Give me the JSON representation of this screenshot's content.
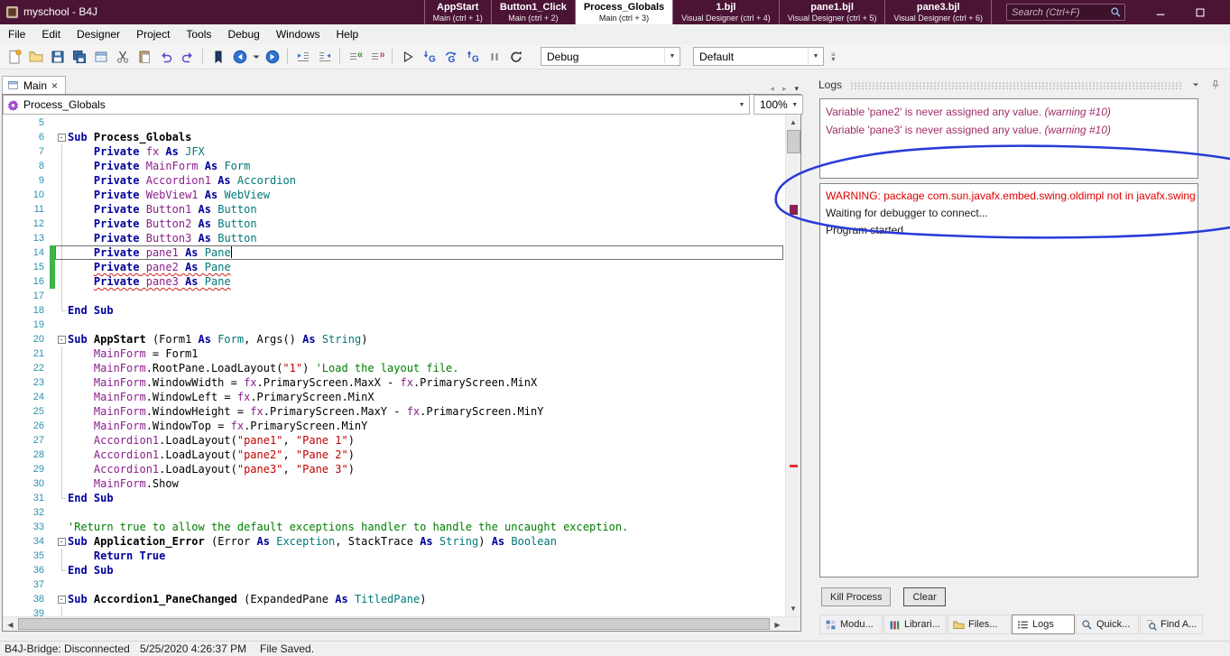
{
  "colors": {
    "titlebar_bg": "#4b1434",
    "annotation_blue": "#2a3bd8",
    "keyword": "#00009b",
    "variable": "#8b1f8b",
    "type": "#007878",
    "string": "#c00000",
    "comment": "#007f00",
    "linenum": "#2b91af",
    "edit_marker_green": "#3cb44a",
    "warn_text": "#a12d66",
    "error_red": "#e00000"
  },
  "titlebar": {
    "app_title": "myschool - B4J",
    "tabs": [
      {
        "title": "AppStart",
        "subtitle": "Main  (ctrl + 1)",
        "active": false
      },
      {
        "title": "Button1_Click",
        "subtitle": "Main  (ctrl + 2)",
        "active": false
      },
      {
        "title": "Process_Globals",
        "subtitle": "Main  (ctrl + 3)",
        "active": true
      },
      {
        "title": "1.bjl",
        "subtitle": "Visual Designer  (ctrl + 4)",
        "active": false
      },
      {
        "title": "pane1.bjl",
        "subtitle": "Visual Designer  (ctrl + 5)",
        "active": false
      },
      {
        "title": "pane3.bjl",
        "subtitle": "Visual Designer  (ctrl + 6)",
        "active": false
      }
    ],
    "search_placeholder": "Search (Ctrl+F)"
  },
  "menubar": {
    "items": [
      "File",
      "Edit",
      "Designer",
      "Project",
      "Tools",
      "Debug",
      "Windows",
      "Help"
    ]
  },
  "toolbar": {
    "icons": [
      "new-file-icon",
      "open-project-icon",
      "save-icon",
      "save-all-icon",
      "designer-icon",
      "cut-icon",
      "paste-icon",
      "undo-icon",
      "redo-icon",
      "sep",
      "bookmark-icon",
      "nav-back-icon",
      "dropdown-arrow-icon",
      "nav-forward-icon",
      "sep",
      "indent-icon",
      "outdent-icon",
      "sep",
      "comment-icon",
      "uncomment-icon",
      "sep",
      "run-icon",
      "step-into-icon",
      "step-over-icon",
      "step-out-icon",
      "pause-icon",
      "restart-icon"
    ],
    "debug_mode": "Debug",
    "build_config": "Default"
  },
  "editor_tab": {
    "label": "Main",
    "close": "×"
  },
  "code_header": {
    "module": "Process_Globals",
    "zoom": "100%"
  },
  "code": {
    "lines": [
      {
        "n": 5,
        "t": []
      },
      {
        "n": 6,
        "fold": true,
        "t": [
          [
            "kw",
            "Sub"
          ],
          [
            "pl",
            " "
          ],
          [
            "nm",
            "Process_Globals"
          ]
        ]
      },
      {
        "n": 7,
        "guide": true,
        "t": [
          [
            "pl",
            "    "
          ],
          [
            "kw",
            "Private"
          ],
          [
            "pl",
            " "
          ],
          [
            "vr",
            "fx"
          ],
          [
            "pl",
            " "
          ],
          [
            "kw",
            "As"
          ],
          [
            "pl",
            " "
          ],
          [
            "ty",
            "JFX"
          ]
        ]
      },
      {
        "n": 8,
        "guide": true,
        "t": [
          [
            "pl",
            "    "
          ],
          [
            "kw",
            "Private"
          ],
          [
            "pl",
            " "
          ],
          [
            "vr",
            "MainForm"
          ],
          [
            "pl",
            " "
          ],
          [
            "kw",
            "As"
          ],
          [
            "pl",
            " "
          ],
          [
            "ty",
            "Form"
          ]
        ]
      },
      {
        "n": 9,
        "guide": true,
        "t": [
          [
            "pl",
            "    "
          ],
          [
            "kw",
            "Private"
          ],
          [
            "pl",
            " "
          ],
          [
            "vr",
            "Accordion1"
          ],
          [
            "pl",
            " "
          ],
          [
            "kw",
            "As"
          ],
          [
            "pl",
            " "
          ],
          [
            "ty",
            "Accordion"
          ]
        ]
      },
      {
        "n": 10,
        "guide": true,
        "t": [
          [
            "pl",
            "    "
          ],
          [
            "kw",
            "Private"
          ],
          [
            "pl",
            " "
          ],
          [
            "vr",
            "WebView1"
          ],
          [
            "pl",
            " "
          ],
          [
            "kw",
            "As"
          ],
          [
            "pl",
            " "
          ],
          [
            "ty",
            "WebView"
          ]
        ]
      },
      {
        "n": 11,
        "guide": true,
        "t": [
          [
            "pl",
            "    "
          ],
          [
            "kw",
            "Private"
          ],
          [
            "pl",
            " "
          ],
          [
            "vr",
            "Button1"
          ],
          [
            "pl",
            " "
          ],
          [
            "kw",
            "As"
          ],
          [
            "pl",
            " "
          ],
          [
            "ty",
            "Button"
          ]
        ]
      },
      {
        "n": 12,
        "guide": true,
        "t": [
          [
            "pl",
            "    "
          ],
          [
            "kw",
            "Private"
          ],
          [
            "pl",
            " "
          ],
          [
            "vr",
            "Button2"
          ],
          [
            "pl",
            " "
          ],
          [
            "kw",
            "As"
          ],
          [
            "pl",
            " "
          ],
          [
            "ty",
            "Button"
          ]
        ]
      },
      {
        "n": 13,
        "guide": true,
        "t": [
          [
            "pl",
            "    "
          ],
          [
            "kw",
            "Private"
          ],
          [
            "pl",
            " "
          ],
          [
            "vr",
            "Button3"
          ],
          [
            "pl",
            " "
          ],
          [
            "kw",
            "As"
          ],
          [
            "pl",
            " "
          ],
          [
            "ty",
            "Button"
          ]
        ]
      },
      {
        "n": 14,
        "guide": true,
        "cur": true,
        "mark": true,
        "caret": true,
        "t": [
          [
            "pl",
            "    "
          ],
          [
            "kw",
            "Private"
          ],
          [
            "pl",
            " "
          ],
          [
            "vr",
            "pane1"
          ],
          [
            "pl",
            " "
          ],
          [
            "kw",
            "As"
          ],
          [
            "pl",
            " "
          ],
          [
            "ty",
            "Pane"
          ]
        ]
      },
      {
        "n": 15,
        "guide": true,
        "warn": true,
        "mark": true,
        "t": [
          [
            "pl",
            "    "
          ],
          [
            "kw",
            "Private"
          ],
          [
            "pl",
            " "
          ],
          [
            "vr",
            "pane2"
          ],
          [
            "pl",
            " "
          ],
          [
            "kw",
            "As"
          ],
          [
            "pl",
            " "
          ],
          [
            "ty",
            "Pane"
          ]
        ]
      },
      {
        "n": 16,
        "guide": true,
        "warn": true,
        "mark": true,
        "t": [
          [
            "pl",
            "    "
          ],
          [
            "kw",
            "Private"
          ],
          [
            "pl",
            " "
          ],
          [
            "vr",
            "pane3"
          ],
          [
            "pl",
            " "
          ],
          [
            "kw",
            "As"
          ],
          [
            "pl",
            " "
          ],
          [
            "ty",
            "Pane"
          ]
        ]
      },
      {
        "n": 17,
        "guide": true,
        "t": []
      },
      {
        "n": 18,
        "gend": true,
        "t": [
          [
            "kw",
            "End Sub"
          ]
        ]
      },
      {
        "n": 19,
        "t": []
      },
      {
        "n": 20,
        "fold": true,
        "t": [
          [
            "kw",
            "Sub"
          ],
          [
            "pl",
            " "
          ],
          [
            "nm",
            "AppStart"
          ],
          [
            "pl",
            " (Form1 "
          ],
          [
            "kw",
            "As"
          ],
          [
            "pl",
            " "
          ],
          [
            "ty",
            "Form"
          ],
          [
            "pl",
            ", Args() "
          ],
          [
            "kw",
            "As"
          ],
          [
            "pl",
            " "
          ],
          [
            "ty",
            "String"
          ],
          [
            "pl",
            ")"
          ]
        ]
      },
      {
        "n": 21,
        "guide": true,
        "t": [
          [
            "pl",
            "    "
          ],
          [
            "vr",
            "MainForm"
          ],
          [
            "pl",
            " = Form1"
          ]
        ]
      },
      {
        "n": 22,
        "guide": true,
        "t": [
          [
            "pl",
            "    "
          ],
          [
            "vr",
            "MainForm"
          ],
          [
            "pl",
            ".RootPane.LoadLayout("
          ],
          [
            "st",
            "\"1\""
          ],
          [
            "pl",
            ") "
          ],
          [
            "cm",
            "'Load the layout file."
          ]
        ]
      },
      {
        "n": 23,
        "guide": true,
        "t": [
          [
            "pl",
            "    "
          ],
          [
            "vr",
            "MainForm"
          ],
          [
            "pl",
            ".WindowWidth = "
          ],
          [
            "vr",
            "fx"
          ],
          [
            "pl",
            ".PrimaryScreen.MaxX - "
          ],
          [
            "vr",
            "fx"
          ],
          [
            "pl",
            ".PrimaryScreen.MinX"
          ]
        ]
      },
      {
        "n": 24,
        "guide": true,
        "t": [
          [
            "pl",
            "    "
          ],
          [
            "vr",
            "MainForm"
          ],
          [
            "pl",
            ".WindowLeft = "
          ],
          [
            "vr",
            "fx"
          ],
          [
            "pl",
            ".PrimaryScreen.MinX"
          ]
        ]
      },
      {
        "n": 25,
        "guide": true,
        "t": [
          [
            "pl",
            "    "
          ],
          [
            "vr",
            "MainForm"
          ],
          [
            "pl",
            ".WindowHeight = "
          ],
          [
            "vr",
            "fx"
          ],
          [
            "pl",
            ".PrimaryScreen.MaxY - "
          ],
          [
            "vr",
            "fx"
          ],
          [
            "pl",
            ".PrimaryScreen.MinY"
          ]
        ]
      },
      {
        "n": 26,
        "guide": true,
        "t": [
          [
            "pl",
            "    "
          ],
          [
            "vr",
            "MainForm"
          ],
          [
            "pl",
            ".WindowTop = "
          ],
          [
            "vr",
            "fx"
          ],
          [
            "pl",
            ".PrimaryScreen.MinY"
          ]
        ]
      },
      {
        "n": 27,
        "guide": true,
        "t": [
          [
            "pl",
            "    "
          ],
          [
            "vr",
            "Accordion1"
          ],
          [
            "pl",
            ".LoadLayout("
          ],
          [
            "st",
            "\"pane1\""
          ],
          [
            "pl",
            ", "
          ],
          [
            "st",
            "\"Pane 1\""
          ],
          [
            "pl",
            ")"
          ]
        ]
      },
      {
        "n": 28,
        "guide": true,
        "t": [
          [
            "pl",
            "    "
          ],
          [
            "vr",
            "Accordion1"
          ],
          [
            "pl",
            ".LoadLayout("
          ],
          [
            "st",
            "\"pane2\""
          ],
          [
            "pl",
            ", "
          ],
          [
            "st",
            "\"Pane 2\""
          ],
          [
            "pl",
            ")"
          ]
        ]
      },
      {
        "n": 29,
        "guide": true,
        "t": [
          [
            "pl",
            "    "
          ],
          [
            "vr",
            "Accordion1"
          ],
          [
            "pl",
            ".LoadLayout("
          ],
          [
            "st",
            "\"pane3\""
          ],
          [
            "pl",
            ", "
          ],
          [
            "st",
            "\"Pane 3\""
          ],
          [
            "pl",
            ")"
          ]
        ]
      },
      {
        "n": 30,
        "guide": true,
        "t": [
          [
            "pl",
            "    "
          ],
          [
            "vr",
            "MainForm"
          ],
          [
            "pl",
            ".Show"
          ]
        ]
      },
      {
        "n": 31,
        "gend": true,
        "t": [
          [
            "kw",
            "End Sub"
          ]
        ]
      },
      {
        "n": 32,
        "t": []
      },
      {
        "n": 33,
        "t": [
          [
            "cm",
            "'Return true to allow the default exceptions handler to handle the uncaught exception."
          ]
        ]
      },
      {
        "n": 34,
        "fold": true,
        "t": [
          [
            "kw",
            "Sub"
          ],
          [
            "pl",
            " "
          ],
          [
            "nm",
            "Application_Error"
          ],
          [
            "pl",
            " (Error "
          ],
          [
            "kw",
            "As"
          ],
          [
            "pl",
            " "
          ],
          [
            "ty",
            "Exception"
          ],
          [
            "pl",
            ", StackTrace "
          ],
          [
            "kw",
            "As"
          ],
          [
            "pl",
            " "
          ],
          [
            "ty",
            "String"
          ],
          [
            "pl",
            ") "
          ],
          [
            "kw",
            "As"
          ],
          [
            "pl",
            " "
          ],
          [
            "ty",
            "Boolean"
          ]
        ]
      },
      {
        "n": 35,
        "guide": true,
        "t": [
          [
            "pl",
            "    "
          ],
          [
            "kw",
            "Return True"
          ]
        ]
      },
      {
        "n": 36,
        "gend": true,
        "t": [
          [
            "kw",
            "End Sub"
          ]
        ]
      },
      {
        "n": 37,
        "t": []
      },
      {
        "n": 38,
        "fold": true,
        "t": [
          [
            "kw",
            "Sub"
          ],
          [
            "pl",
            " "
          ],
          [
            "nm",
            "Accordion1_PaneChanged"
          ],
          [
            "pl",
            " (ExpandedPane "
          ],
          [
            "kw",
            "As"
          ],
          [
            "pl",
            " "
          ],
          [
            "ty",
            "TitledPane"
          ],
          [
            "pl",
            ")"
          ]
        ]
      },
      {
        "n": 39,
        "guide": true,
        "t": []
      }
    ]
  },
  "logs": {
    "title": "Logs",
    "warnings": [
      {
        "text": "Variable 'pane2' is never assigned any value. ",
        "suffix": "(warning #10)"
      },
      {
        "text": "Variable 'pane3' is never assigned any value. ",
        "suffix": "(warning #10)"
      }
    ],
    "output": [
      {
        "text": "WARNING: package com.sun.javafx.embed.swing.oldimpl not in javafx.swing",
        "color": "red"
      },
      {
        "text": "Waiting for debugger to connect...",
        "color": "black"
      },
      {
        "text": "Program started.",
        "color": "black"
      }
    ],
    "buttons": {
      "kill": "Kill Process",
      "clear": "Clear"
    },
    "bottom_tabs": [
      {
        "label": "Modu...",
        "icon": "modules-icon",
        "active": false
      },
      {
        "label": "Librari...",
        "icon": "libraries-icon",
        "active": false
      },
      {
        "label": "Files...",
        "icon": "files-icon",
        "active": false
      },
      {
        "label": "Logs",
        "icon": "logs-icon",
        "active": true
      },
      {
        "label": "Quick...",
        "icon": "quick-search-icon",
        "active": false
      },
      {
        "label": "Find A...",
        "icon": "find-all-icon",
        "active": false
      }
    ]
  },
  "statusbar": {
    "bridge": "B4J-Bridge: Disconnected",
    "timestamp": "5/25/2020 4:26:37 PM",
    "file_status": "File Saved."
  }
}
